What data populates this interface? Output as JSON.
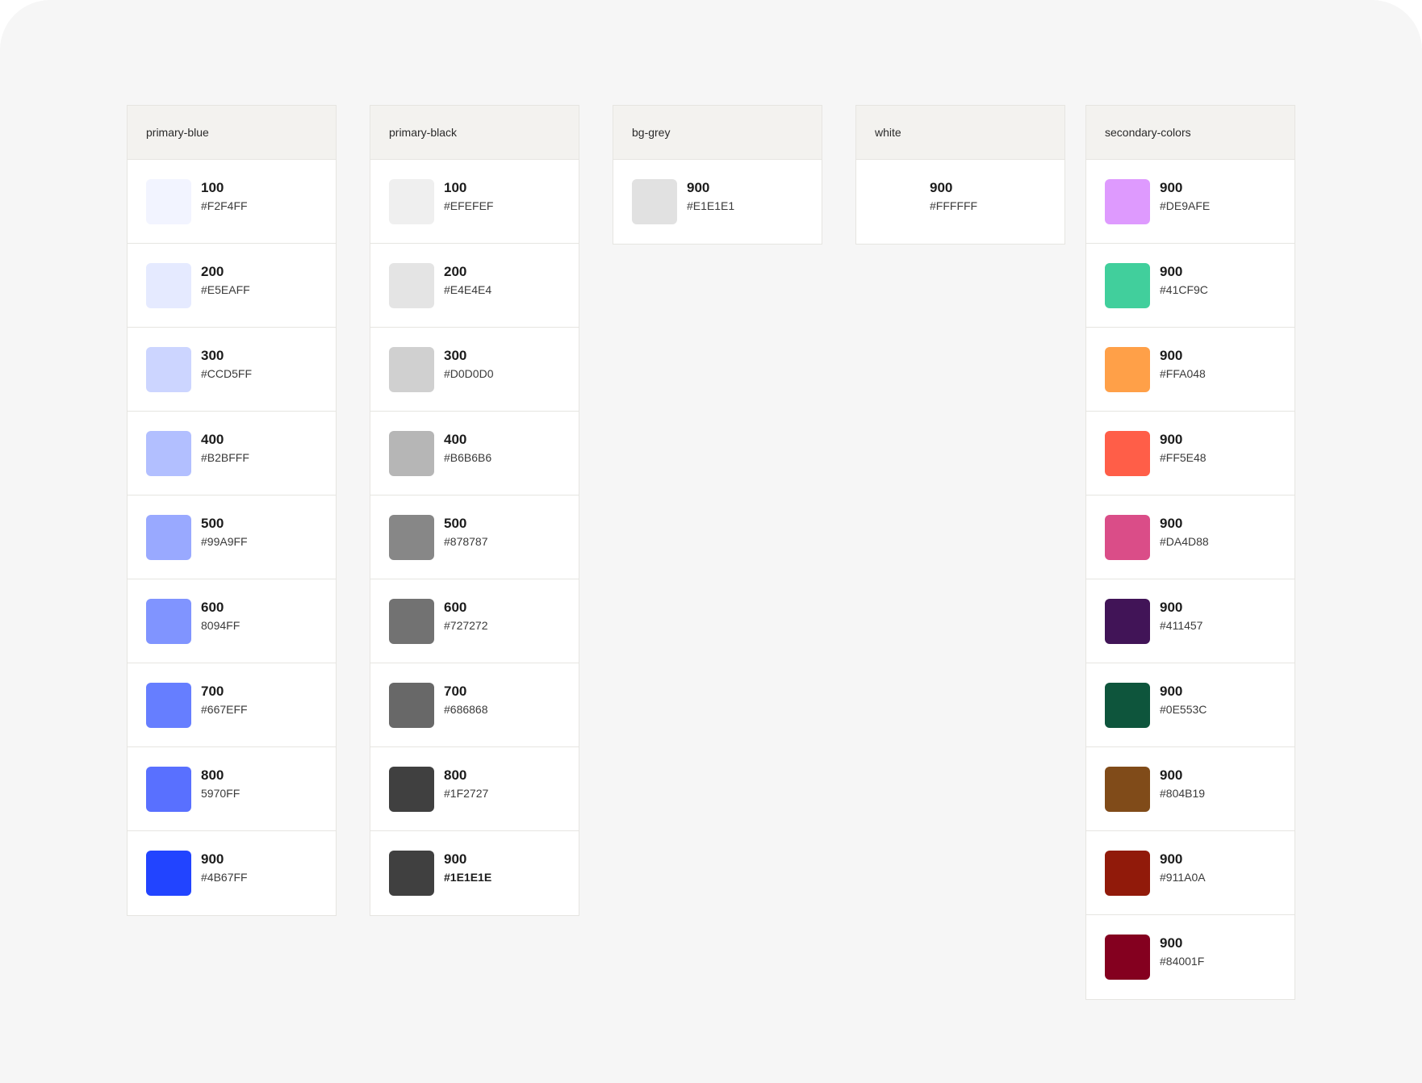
{
  "palettes": [
    {
      "name": "primary-blue",
      "swatches": [
        {
          "shade": "100",
          "hex": "#F2F4FF",
          "color": "#F2F4FF"
        },
        {
          "shade": "200",
          "hex": "#E5EAFF",
          "color": "#E5EAFF"
        },
        {
          "shade": "300",
          "hex": "#CCD5FF",
          "color": "#CCD5FF"
        },
        {
          "shade": "400",
          "hex": "#B2BFFF",
          "color": "#B2BFFF"
        },
        {
          "shade": "500",
          "hex": "#99A9FF",
          "color": "#99A9FF"
        },
        {
          "shade": "600",
          "hex": "8094FF",
          "color": "#8094FF"
        },
        {
          "shade": "700",
          "hex": "#667EFF",
          "color": "#667EFF"
        },
        {
          "shade": "800",
          "hex": "5970FF",
          "color": "#5970FF"
        },
        {
          "shade": "900",
          "hex": "#4B67FF",
          "color": "#2244FF"
        }
      ]
    },
    {
      "name": "primary-black",
      "swatches": [
        {
          "shade": "100",
          "hex": "#EFEFEF",
          "color": "#EFEFEF"
        },
        {
          "shade": "200",
          "hex": "#E4E4E4",
          "color": "#E4E4E4"
        },
        {
          "shade": "300",
          "hex": "#D0D0D0",
          "color": "#D0D0D0"
        },
        {
          "shade": "400",
          "hex": "#B6B6B6",
          "color": "#B6B6B6"
        },
        {
          "shade": "500",
          "hex": "#878787",
          "color": "#878787"
        },
        {
          "shade": "600",
          "hex": "#727272",
          "color": "#727272"
        },
        {
          "shade": "700",
          "hex": "#686868",
          "color": "#686868"
        },
        {
          "shade": "800",
          "hex": "#1F2727",
          "color": "#404040"
        },
        {
          "shade": "900",
          "hex": "#1E1E1E",
          "color": "#404040",
          "hex_bold": true
        }
      ]
    },
    {
      "name": "bg-grey",
      "swatches": [
        {
          "shade": "900",
          "hex": "#E1E1E1",
          "color": "#E1E1E1"
        }
      ]
    },
    {
      "name": "white",
      "swatches": [
        {
          "shade": "900",
          "hex": "#FFFFFF",
          "color": "#FFFFFF"
        }
      ]
    },
    {
      "name": "secondary-colors",
      "swatches": [
        {
          "shade": "900",
          "hex": "#DE9AFE",
          "color": "#DE9AFE"
        },
        {
          "shade": "900",
          "hex": "#41CF9C",
          "color": "#41CF9C"
        },
        {
          "shade": "900",
          "hex": "#FFA048",
          "color": "#FFA048"
        },
        {
          "shade": "900",
          "hex": "#FF5E48",
          "color": "#FF5E48"
        },
        {
          "shade": "900",
          "hex": "#DA4D88",
          "color": "#DA4D88"
        },
        {
          "shade": "900",
          "hex": "#411457",
          "color": "#411457"
        },
        {
          "shade": "900",
          "hex": "#0E553C",
          "color": "#0E553C"
        },
        {
          "shade": "900",
          "hex": "#804B19",
          "color": "#804B19"
        },
        {
          "shade": "900",
          "hex": "#911A0A",
          "color": "#911A0A"
        },
        {
          "shade": "900",
          "hex": "#84001F",
          "color": "#84001F"
        }
      ]
    }
  ]
}
